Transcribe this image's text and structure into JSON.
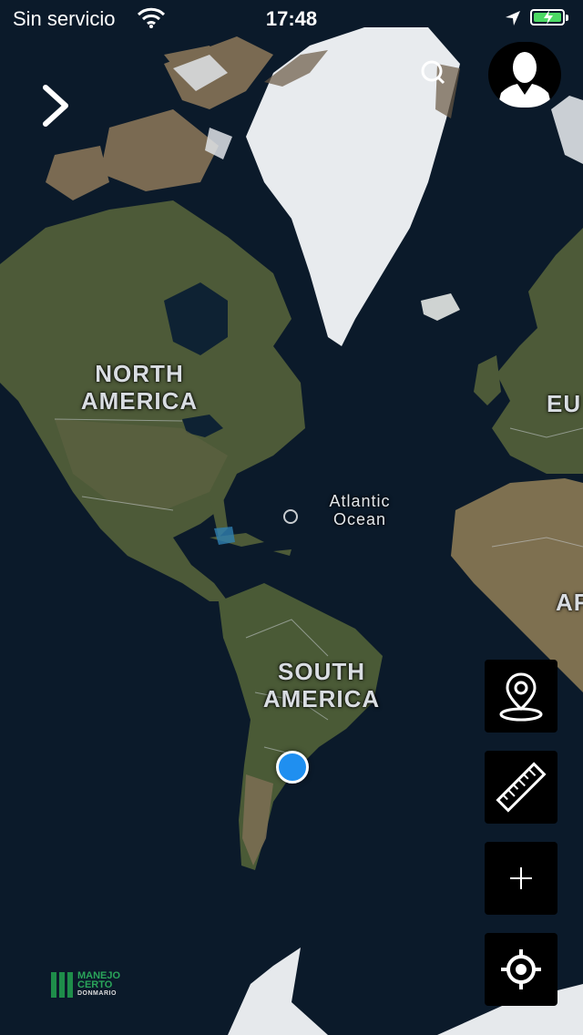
{
  "status_bar": {
    "carrier": "Sin servicio",
    "time": "17:48",
    "icons": [
      "wifi-icon",
      "location-arrow-icon",
      "battery-charging-icon"
    ]
  },
  "map": {
    "style": "satellite",
    "labels": {
      "north_america": [
        "NORTH",
        "AMERICA"
      ],
      "south_america": [
        "SOUTH",
        "AMERICA"
      ],
      "atlantic": [
        "Atlantic",
        "Ocean"
      ],
      "europe": "EU",
      "africa": "AF"
    },
    "colors": {
      "ocean": "#0b1a2a",
      "land": "#4a5535",
      "ice": "#e9ecef",
      "user_location": "#1f8ff0"
    }
  },
  "controls": {
    "menu_icon": "chevron-right-icon",
    "profile_icon": "user-silhouette-icon",
    "search_icon": "search-icon",
    "tools": [
      "map-pin-icon",
      "ruler-icon",
      "plus-icon",
      "crosshair-locate-icon"
    ]
  },
  "brand": {
    "line1": "MANEJO",
    "line2": "CERTO",
    "line3": "DONMARIO",
    "color": "#1e8d4a"
  }
}
